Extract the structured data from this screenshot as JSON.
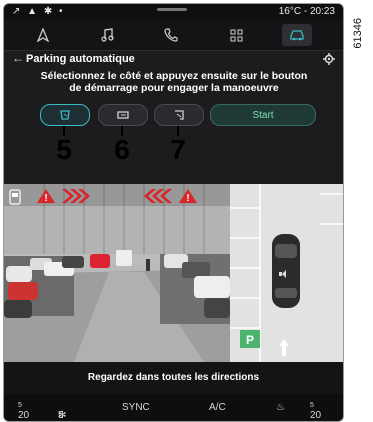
{
  "status": {
    "icons_left": "↗ ▲ ✱ •",
    "temperature": "16°C",
    "separator": "-",
    "time": "20:23"
  },
  "nav": {
    "tabs": [
      {
        "name": "navigation-icon"
      },
      {
        "name": "music-icon"
      },
      {
        "name": "phone-icon"
      },
      {
        "name": "apps-grid-icon"
      },
      {
        "name": "car-icon",
        "active": true
      }
    ]
  },
  "header": {
    "title": "Parking automatique"
  },
  "instruction": {
    "line1": "Sélectionnez le côté et appuyez ensuite sur le bouton",
    "line2": "de démarrage pour engager la manoeuvre"
  },
  "buttons": {
    "start_label": "Start"
  },
  "callouts": [
    "5",
    "6",
    "7"
  ],
  "bottom_message": "Regardez dans toutes les directions",
  "climate": {
    "left_temp": "20",
    "left_temp_decimal": "5",
    "fan_level": "5",
    "sync": "SYNC",
    "ac": "A/C",
    "right_temp": "20",
    "right_temp_decimal": "5"
  },
  "figure_code": "61346",
  "colors": {
    "accent": "#39b9c4",
    "warning_red": "#d8262b",
    "parking_green": "#4db36e"
  }
}
